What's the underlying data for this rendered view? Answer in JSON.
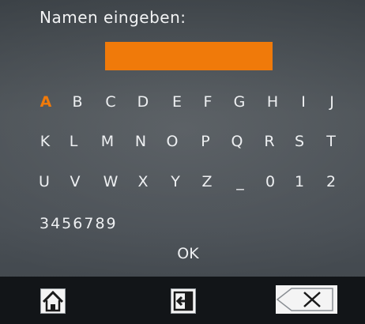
{
  "prompt": "Namen  eingeben:",
  "name_field": {
    "value": ""
  },
  "keyboard": {
    "selected": "A",
    "rows": [
      [
        "A",
        "B",
        "C",
        "D",
        "E",
        "F",
        "G",
        "H",
        "I",
        "J"
      ],
      [
        "K",
        "L",
        "M",
        "N",
        "O",
        "P",
        "Q",
        "R",
        "S",
        "T"
      ],
      [
        "U",
        "V",
        "W",
        "X",
        "Y",
        "Z",
        "_",
        "0",
        "1",
        "2"
      ]
    ],
    "digits": "3456789",
    "ok_label": "OK"
  },
  "toolbar": {
    "home_icon": "home-icon",
    "enter_icon": "enter-icon",
    "backspace_icon": "backspace-icon"
  },
  "colors": {
    "accent": "#f07a0a",
    "background": "#464c52",
    "bar": "#121518",
    "text": "#eef0f2"
  }
}
